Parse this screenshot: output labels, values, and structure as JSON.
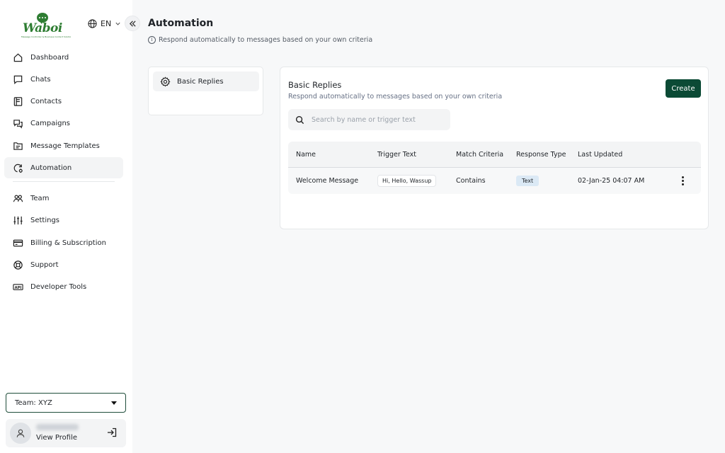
{
  "brand": {
    "name": "Waboi",
    "tagline": "Message Controller & Business Contact Solution"
  },
  "language": {
    "code": "EN"
  },
  "sidebar": {
    "items": [
      {
        "label": "Dashboard",
        "icon": "home-icon"
      },
      {
        "label": "Chats",
        "icon": "chat-icon"
      },
      {
        "label": "Contacts",
        "icon": "contacts-icon"
      },
      {
        "label": "Campaigns",
        "icon": "campaigns-icon"
      },
      {
        "label": "Message Templates",
        "icon": "template-icon"
      },
      {
        "label": "Automation",
        "icon": "automation-icon",
        "active": true
      },
      {
        "label": "Team",
        "icon": "team-icon"
      },
      {
        "label": "Settings",
        "icon": "settings-sliders-icon"
      },
      {
        "label": "Billing & Subscription",
        "icon": "credit-card-icon"
      },
      {
        "label": "Support",
        "icon": "lifebuoy-icon"
      },
      {
        "label": "Developer Tools",
        "icon": "api-icon"
      }
    ],
    "team_select": "Team: XYZ",
    "profile": {
      "view_label": "View Profile"
    }
  },
  "header": {
    "title": "Automation",
    "subtitle": "Respond automatically to messages based on your own criteria"
  },
  "left_panel": {
    "item_label": "Basic Replies"
  },
  "card": {
    "title": "Basic Replies",
    "subtitle": "Respond automatically to messages based on your own criteria",
    "create_label": "Create",
    "search_placeholder": "Search by name or trigger text"
  },
  "table": {
    "columns": [
      "Name",
      "Trigger Text",
      "Match Criteria",
      "Response Type",
      "Last Updated"
    ],
    "rows": [
      {
        "name": "Welcome Message",
        "trigger": "Hi, Hello, Wassup",
        "match": "Contains",
        "response_type": "Text",
        "updated": "02-Jan-25 04:07 AM"
      }
    ]
  },
  "colors": {
    "brand_green": "#2e7d32",
    "primary_button": "#0b4a35",
    "badge_bg": "#dbe9f5"
  }
}
